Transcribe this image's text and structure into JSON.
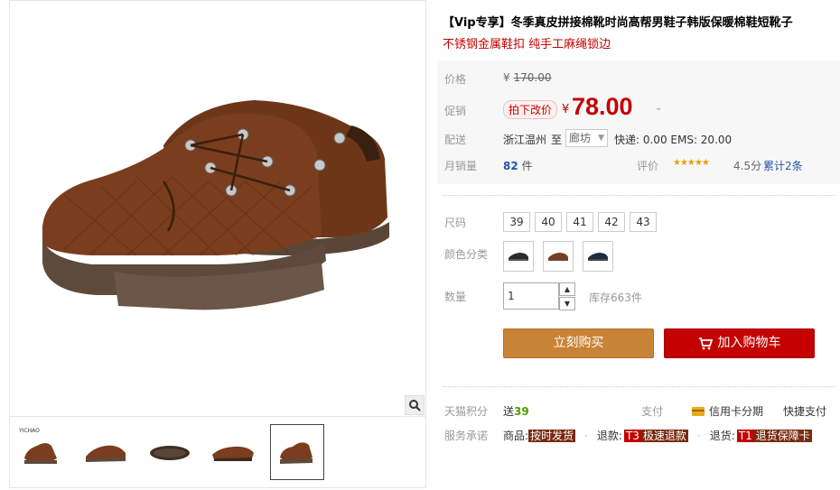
{
  "title": "【Vip专享】冬季真皮拼接棉靴时尚高帮男鞋子韩版保暖棉鞋短靴子",
  "subtitle": "不锈钢金属鞋扣 纯手工麻绳锁边",
  "price": {
    "label": "价格",
    "currency": "¥",
    "original": "170.00"
  },
  "promo": {
    "label": "促销",
    "tag": "拍下改价",
    "currency": "¥",
    "price": "78.00"
  },
  "shipping": {
    "label": "配送",
    "from": "浙江温州",
    "to_word": "至",
    "city": "廊坊",
    "fee": "快递: 0.00 EMS: 20.00"
  },
  "sales": {
    "label": "月销量",
    "count": "82",
    "unit": "件"
  },
  "rating": {
    "label": "评价",
    "stars": "★★★★★",
    "score": "4.5分",
    "reviews": "累计2条"
  },
  "size": {
    "label": "尺码",
    "options": [
      "39",
      "40",
      "41",
      "42",
      "43"
    ]
  },
  "color": {
    "label": "颜色分类",
    "options": [
      "black",
      "brown",
      "navy"
    ]
  },
  "quantity": {
    "label": "数量",
    "value": "1",
    "stock": "库存663件"
  },
  "buttons": {
    "buy": "立刻购买",
    "cart": "加入购物车"
  },
  "points": {
    "label": "天猫积分",
    "prefix": "送",
    "value": "39"
  },
  "payment": {
    "label": "支付",
    "credit": "信用卡分期",
    "quick": "快捷支付"
  },
  "service": {
    "label": "服务承诺",
    "goods_label": "商品:",
    "goods_tag": "按时发货",
    "refund_label": "退款:",
    "refund_num": "T3",
    "refund_tag": "极速退款",
    "return_label": "退货:",
    "return_num": "T1",
    "return_tag": "退货保障卡"
  },
  "gallery": {
    "brand": "YICHAO",
    "zoom_icon": "magnifier-icon"
  },
  "colors": {
    "accent_red": "#c40000",
    "buy_button": "#c98337",
    "shoe_brown": "#7a3d1d"
  }
}
